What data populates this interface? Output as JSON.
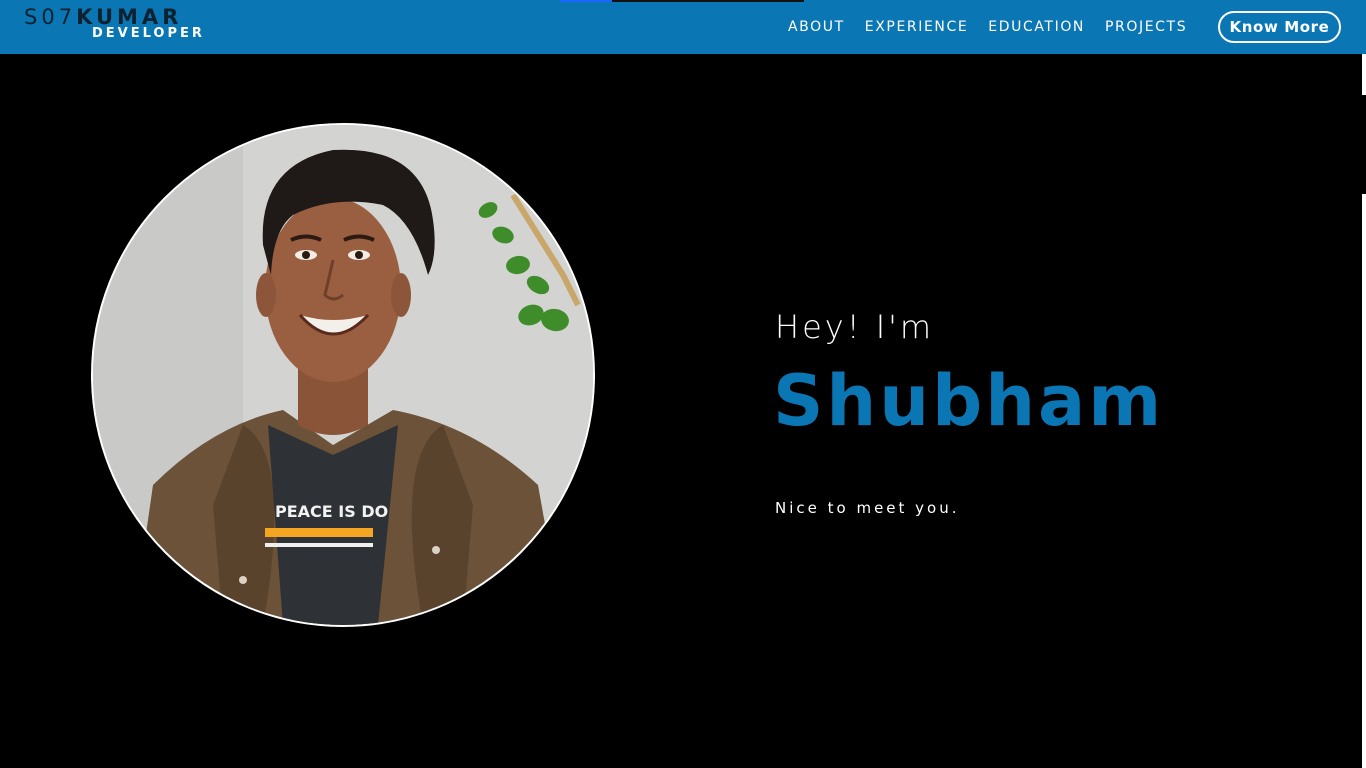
{
  "brand": {
    "logo_part1": "S07",
    "logo_part2": "KUMAR",
    "logo_sub": "DEVELOPER"
  },
  "nav": {
    "items": [
      {
        "label": "ABOUT"
      },
      {
        "label": "EXPERIENCE"
      },
      {
        "label": "EDUCATION"
      },
      {
        "label": "PROJECTS"
      }
    ],
    "cta_label": "Know More"
  },
  "hero": {
    "greeting": "Hey! I'm",
    "name": "Shubham",
    "tagline": "Nice to meet you.",
    "photo_shirt_text": "PEACE IS DO"
  },
  "colors": {
    "accent": "#0a76b3",
    "background": "#000000",
    "text": "#ffffff"
  }
}
